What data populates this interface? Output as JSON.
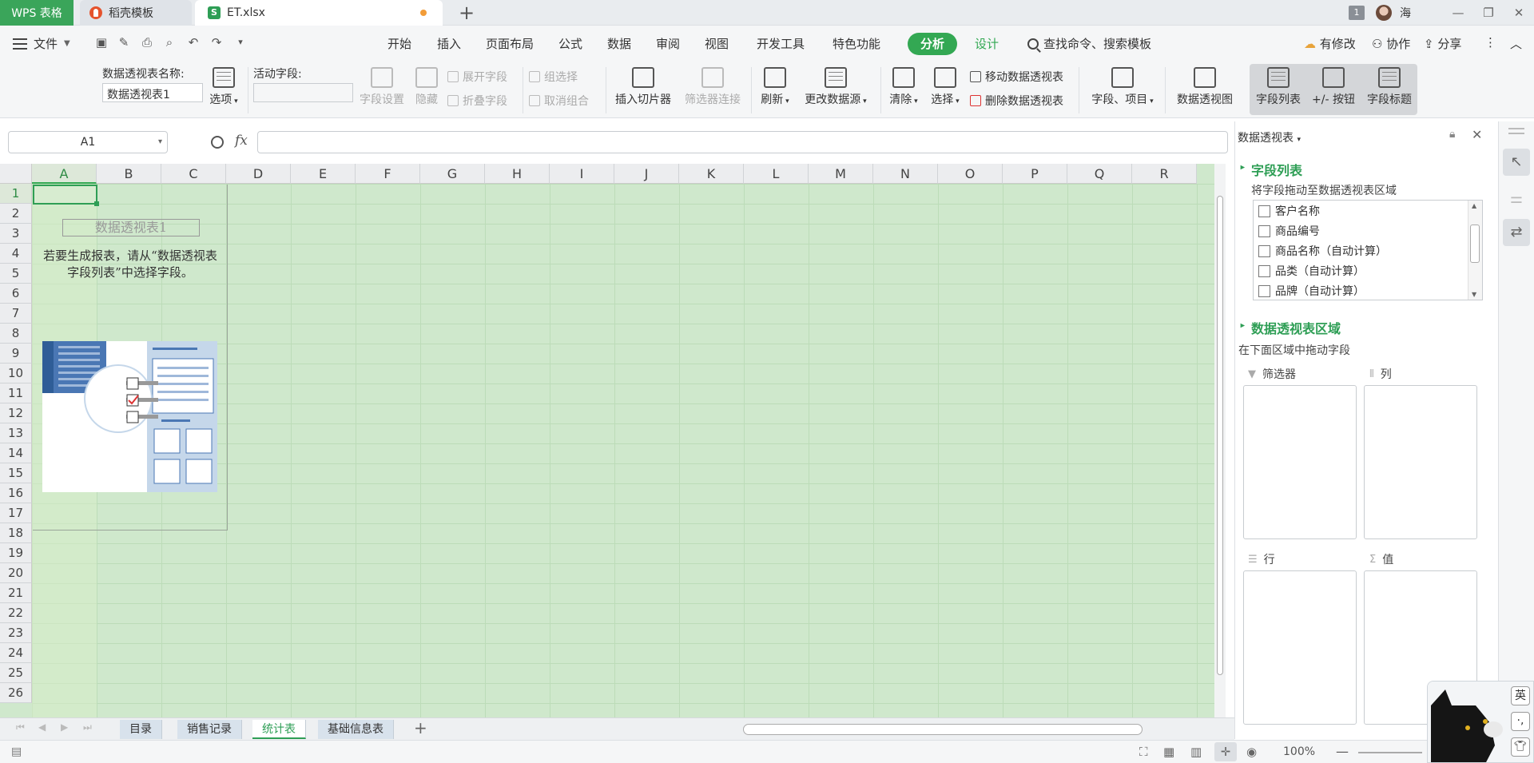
{
  "titlebar": {
    "tabs": [
      {
        "label": "WPS 表格"
      },
      {
        "label": "稻壳模板"
      },
      {
        "label": "ET.xlsx"
      }
    ],
    "window_count": "1",
    "user": "海"
  },
  "menu": {
    "file": "文件",
    "items": [
      "开始",
      "插入",
      "页面布局",
      "公式",
      "数据",
      "审阅",
      "视图",
      "开发工具",
      "特色功能"
    ],
    "analysis": "分析",
    "design": "设计",
    "search": "查找命令、搜索模板",
    "modified": "有修改",
    "collab": "协作",
    "share": "分享"
  },
  "ribbon": {
    "pivot_name_label": "数据透视表名称:",
    "pivot_name_value": "数据透视表1",
    "options": "选项",
    "active_field_label": "活动字段:",
    "field_settings": "字段设置",
    "hide": "隐藏",
    "expand_field": "展开字段",
    "collapse_field": "折叠字段",
    "group_selection": "组选择",
    "ungroup": "取消组合",
    "insert_slicer": "插入切片器",
    "filter_connections": "筛选器连接",
    "refresh": "刷新",
    "change_source": "更改数据源",
    "clear": "清除",
    "select": "选择",
    "move_pivot": "移动数据透视表",
    "delete_pivot": "删除数据透视表",
    "fields_items": "字段、项目",
    "pivot_chart": "数据透视图",
    "field_list": "字段列表",
    "plus_minus": "+/- 按钮",
    "field_headers": "字段标题"
  },
  "formula": {
    "namebox": "A1",
    "fx": "fx",
    "value": ""
  },
  "grid": {
    "columns": [
      "A",
      "B",
      "C",
      "D",
      "E",
      "F",
      "G",
      "H",
      "I",
      "J",
      "K",
      "L",
      "M",
      "N",
      "O",
      "P",
      "Q",
      "R"
    ],
    "rows": [
      "1",
      "2",
      "3",
      "4",
      "5",
      "6",
      "7",
      "8",
      "9",
      "10",
      "11",
      "12",
      "13",
      "14",
      "15",
      "16",
      "17",
      "18",
      "19",
      "20",
      "21",
      "22",
      "23",
      "24",
      "25",
      "26"
    ],
    "pivot_placeholder_title": "数据透视表1",
    "pivot_hint": "若要生成报表，请从“数据透视表字段列表”中选择字段。"
  },
  "sheets": [
    "目录",
    "销售记录",
    "统计表",
    "基础信息表"
  ],
  "active_sheet": "统计表",
  "status": {
    "zoom": "100%"
  },
  "pane": {
    "title": "数据透视表",
    "field_list_header": "字段列表",
    "field_list_hint": "将字段拖动至数据透视表区域",
    "fields": [
      "客户名称",
      "商品编号",
      "商品名称（自动计算）",
      "品类（自动计算）",
      "品牌（自动计算）"
    ],
    "areas_header": "数据透视表区域",
    "areas_hint": "在下面区域中拖动字段",
    "zones": {
      "filter": "筛选器",
      "columns": "列",
      "rows": "行",
      "values": "值"
    }
  },
  "ime": {
    "lang": "英"
  },
  "colors": {
    "accent": "#33a853",
    "grid_bg": "#cfe8cc"
  }
}
